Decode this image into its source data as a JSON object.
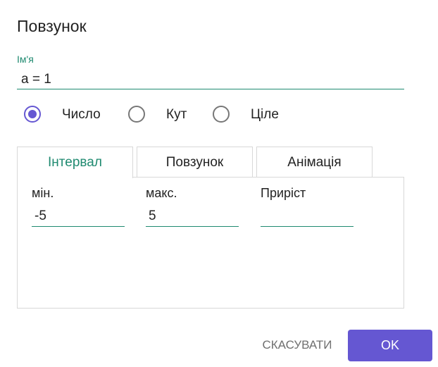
{
  "dialog": {
    "title": "Повзунок",
    "name_label": "Ім'я",
    "name_value": "a = 1"
  },
  "type_options": [
    {
      "label": "Число",
      "checked": true
    },
    {
      "label": "Кут",
      "checked": false
    },
    {
      "label": "Ціле",
      "checked": false
    }
  ],
  "tabs": [
    {
      "label": "Інтервал",
      "active": true
    },
    {
      "label": "Повзунок",
      "active": false
    },
    {
      "label": "Анімація",
      "active": false
    }
  ],
  "interval": {
    "min_label": "мін.",
    "min_value": "-5",
    "max_label": "макс.",
    "max_value": "5",
    "step_label": "Приріст",
    "step_value": ""
  },
  "buttons": {
    "cancel": "СКАСУВАТИ",
    "ok": "OK"
  },
  "colors": {
    "accent": "#6557d2",
    "field_underline": "#1f8a70"
  }
}
